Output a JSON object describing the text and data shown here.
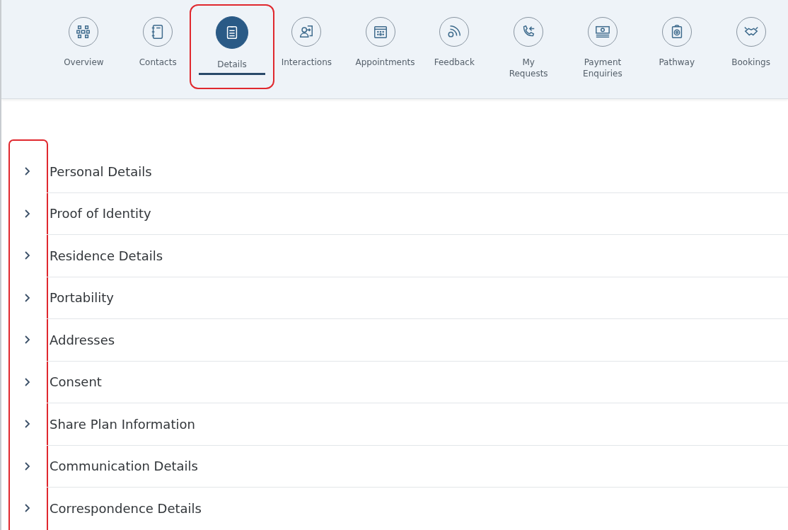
{
  "tabs": [
    {
      "label": "Overview",
      "selected": false,
      "highlighted": false
    },
    {
      "label": "Contacts",
      "selected": false,
      "highlighted": false
    },
    {
      "label": "Details",
      "selected": true,
      "highlighted": true
    },
    {
      "label": "Interactions",
      "selected": false,
      "highlighted": false
    },
    {
      "label": "Appointments",
      "selected": false,
      "highlighted": false
    },
    {
      "label": "Feedback",
      "selected": false,
      "highlighted": false
    },
    {
      "label": "My Requests",
      "selected": false,
      "highlighted": false
    },
    {
      "label": "Payment Enquiries",
      "selected": false,
      "highlighted": false
    },
    {
      "label": "Pathway",
      "selected": false,
      "highlighted": false
    },
    {
      "label": "Bookings",
      "selected": false,
      "highlighted": false
    }
  ],
  "sections": {
    "chevrons_highlighted": true,
    "items": [
      {
        "title": "Personal Details",
        "expanded": false
      },
      {
        "title": "Proof of Identity",
        "expanded": false
      },
      {
        "title": "Residence Details",
        "expanded": false
      },
      {
        "title": "Portability",
        "expanded": false
      },
      {
        "title": "Addresses",
        "expanded": false
      },
      {
        "title": "Consent",
        "expanded": false
      },
      {
        "title": "Share Plan Information",
        "expanded": false
      },
      {
        "title": "Communication Details",
        "expanded": false
      },
      {
        "title": "Correspondence Details",
        "expanded": false
      }
    ]
  }
}
